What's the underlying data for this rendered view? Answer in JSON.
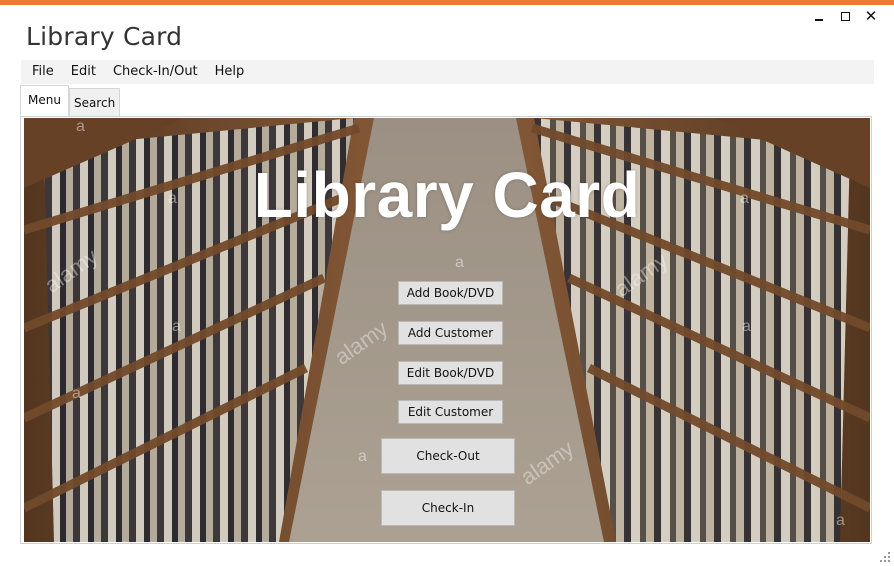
{
  "window": {
    "title": "Library Card"
  },
  "menu": {
    "items": [
      "File",
      "Edit",
      "Check-In/Out",
      "Help"
    ]
  },
  "tabs": [
    {
      "label": "Menu",
      "active": true
    },
    {
      "label": "Search",
      "active": false
    }
  ],
  "hero": {
    "title": "Library Card"
  },
  "buttons": {
    "add_book": "Add Book/DVD",
    "add_customer": "Add Customer",
    "edit_book": "Edit Book/DVD",
    "edit_customer": "Edit Customer",
    "check_out": "Check-Out",
    "check_in": "Check-In"
  },
  "watermark": {
    "brand": "alamy",
    "mark": "a"
  },
  "colors": {
    "accent": "#f07b2e",
    "button_bg": "#e1e1e1",
    "hero_text": "#ffffff"
  }
}
